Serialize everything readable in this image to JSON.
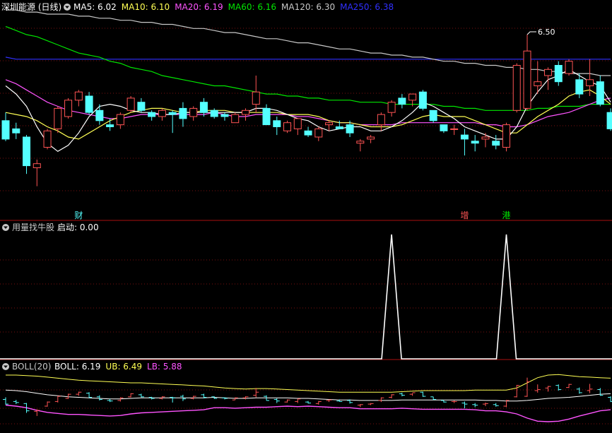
{
  "colors": {
    "up": "#ff5454",
    "down": "#54ffff",
    "ma5": "#ffffff",
    "ma10": "#ffff54",
    "ma20": "#ff54ff",
    "ma60": "#00e600",
    "ma120": "#c8c8c8",
    "ma250": "#3030ff",
    "grid": "#7a1010",
    "panel_border": "#aa1010",
    "signal": "#ffffff",
    "boll_mid": "#ffffff",
    "boll_ub": "#ffff54",
    "boll_lb": "#ff54ff"
  },
  "main": {
    "title": "深圳能源 (日线)",
    "legend": [
      {
        "key": "ma5",
        "text": "MA5: 6.02"
      },
      {
        "key": "ma10",
        "text": "MA10: 6.10"
      },
      {
        "key": "ma20",
        "text": "MA20: 6.19"
      },
      {
        "key": "ma60",
        "text": "MA60: 6.16"
      },
      {
        "key": "ma120",
        "text": "MA120: 6.30"
      },
      {
        "key": "ma250",
        "text": "MA250: 6.38"
      }
    ],
    "high_annotation": "6.50",
    "markers": [
      {
        "text": "财",
        "index": 7,
        "color": "#54ffff"
      },
      {
        "text": "增",
        "index": 44,
        "color": "#ff5454"
      },
      {
        "text": "港",
        "index": 48,
        "color": "#00e600"
      }
    ]
  },
  "indicator": {
    "title": "用量找牛股",
    "legend": [
      {
        "key": "signal",
        "text": "启动: 0.00"
      }
    ]
  },
  "boll": {
    "title": "BOLL(20)",
    "legend": [
      {
        "key": "boll_mid",
        "text": "BOLL: 6.19"
      },
      {
        "key": "boll_ub",
        "text": "UB: 6.49"
      },
      {
        "key": "boll_lb",
        "text": "LB: 5.88"
      }
    ]
  },
  "chart_data": [
    {
      "type": "candlestick",
      "yrange": [
        5.6,
        6.6
      ],
      "ohlc": [
        [
          6.08,
          6.12,
          5.98,
          5.99
        ],
        [
          6.04,
          6.07,
          5.99,
          6.02
        ],
        [
          6.0,
          6.01,
          5.82,
          5.86
        ],
        [
          5.85,
          5.89,
          5.76,
          5.87
        ],
        [
          5.95,
          6.04,
          5.94,
          6.03
        ],
        [
          6.04,
          6.15,
          6.02,
          6.14
        ],
        [
          6.1,
          6.19,
          6.09,
          6.18
        ],
        [
          6.18,
          6.23,
          6.15,
          6.22
        ],
        [
          6.2,
          6.22,
          6.11,
          6.12
        ],
        [
          6.13,
          6.16,
          6.06,
          6.08
        ],
        [
          6.06,
          6.09,
          6.03,
          6.05
        ],
        [
          6.06,
          6.12,
          6.04,
          6.11
        ],
        [
          6.13,
          6.2,
          6.12,
          6.19
        ],
        [
          6.17,
          6.19,
          6.12,
          6.13
        ],
        [
          6.12,
          6.13,
          6.08,
          6.1
        ],
        [
          6.1,
          6.14,
          6.08,
          6.13
        ],
        [
          6.12,
          6.13,
          6.02,
          6.11
        ],
        [
          6.14,
          6.17,
          6.05,
          6.09
        ],
        [
          6.1,
          6.15,
          6.08,
          6.14
        ],
        [
          6.17,
          6.19,
          6.1,
          6.12
        ],
        [
          6.13,
          6.14,
          6.09,
          6.1
        ],
        [
          6.11,
          6.12,
          6.08,
          6.1
        ],
        [
          6.07,
          6.12,
          6.07,
          6.11
        ],
        [
          6.11,
          6.14,
          6.08,
          6.13
        ],
        [
          6.16,
          6.3,
          6.12,
          6.22
        ],
        [
          6.14,
          6.16,
          6.06,
          6.06
        ],
        [
          6.08,
          6.1,
          6.01,
          6.05
        ],
        [
          6.03,
          6.08,
          6.02,
          6.07
        ],
        [
          6.04,
          6.09,
          6.01,
          6.09
        ],
        [
          6.03,
          6.05,
          6.0,
          6.01
        ],
        [
          6.0,
          6.05,
          5.98,
          6.04
        ],
        [
          6.06,
          6.08,
          6.03,
          6.07
        ],
        [
          6.05,
          6.08,
          6.04,
          6.04
        ],
        [
          6.06,
          6.08,
          6.0,
          6.02
        ],
        [
          5.97,
          5.99,
          5.93,
          5.98
        ],
        [
          5.99,
          6.01,
          5.97,
          6.0
        ],
        [
          6.06,
          6.12,
          6.03,
          6.11
        ],
        [
          6.12,
          6.18,
          6.1,
          6.17
        ],
        [
          6.19,
          6.21,
          6.14,
          6.16
        ],
        [
          6.18,
          6.2,
          6.15,
          6.21
        ],
        [
          6.22,
          6.23,
          6.13,
          6.14
        ],
        [
          6.13,
          6.13,
          6.07,
          6.08
        ],
        [
          6.06,
          6.06,
          6.02,
          6.03
        ],
        [
          6.04,
          6.06,
          6.01,
          6.04
        ],
        [
          6.01,
          6.04,
          5.91,
          5.99
        ],
        [
          5.98,
          6.01,
          5.93,
          5.97
        ],
        [
          5.99,
          6.02,
          5.95,
          6.0
        ],
        [
          5.98,
          6.01,
          5.94,
          5.96
        ],
        [
          5.95,
          6.07,
          5.93,
          6.06
        ],
        [
          6.13,
          6.36,
          6.12,
          6.35
        ],
        [
          6.14,
          6.5,
          6.13,
          6.42
        ],
        [
          6.25,
          6.37,
          6.21,
          6.27
        ],
        [
          6.3,
          6.34,
          6.23,
          6.33
        ],
        [
          6.35,
          6.37,
          6.25,
          6.27
        ],
        [
          6.31,
          6.38,
          6.3,
          6.37
        ],
        [
          6.28,
          6.31,
          6.19,
          6.21
        ],
        [
          6.25,
          6.38,
          6.2,
          6.28
        ],
        [
          6.27,
          6.3,
          6.15,
          6.16
        ],
        [
          6.12,
          6.14,
          6.03,
          6.04
        ]
      ],
      "ma": {
        "ma5": [
          6.25,
          6.21,
          6.15,
          6.05,
          5.97,
          5.93,
          5.96,
          6.02,
          6.1,
          6.15,
          6.16,
          6.15,
          6.13,
          6.12,
          6.12,
          6.11,
          6.11,
          6.12,
          6.12,
          6.12,
          6.12,
          6.12,
          6.12,
          6.12,
          6.14,
          6.14,
          6.13,
          6.11,
          6.09,
          6.08,
          6.05,
          6.03,
          6.04,
          6.05,
          6.05,
          6.03,
          6.03,
          6.05,
          6.08,
          6.12,
          6.17,
          6.15,
          6.12,
          6.09,
          6.05,
          6.03,
          6.01,
          5.99,
          5.99,
          6.05,
          6.15,
          6.22,
          6.28,
          6.3,
          6.33,
          6.3,
          6.27,
          6.25,
          6.17
        ],
        "ma10": [
          6.12,
          6.11,
          6.1,
          6.08,
          6.05,
          6.03,
          6.0,
          5.99,
          6.02,
          6.05,
          6.08,
          6.1,
          6.12,
          6.13,
          6.14,
          6.14,
          6.13,
          6.12,
          6.12,
          6.13,
          6.13,
          6.13,
          6.12,
          6.12,
          6.12,
          6.12,
          6.12,
          6.11,
          6.11,
          6.11,
          6.1,
          6.08,
          6.07,
          6.07,
          6.06,
          6.05,
          6.05,
          6.05,
          6.06,
          6.08,
          6.1,
          6.11,
          6.1,
          6.1,
          6.1,
          6.08,
          6.06,
          6.04,
          6.02,
          6.02,
          6.06,
          6.1,
          6.13,
          6.16,
          6.2,
          6.22,
          6.23,
          6.2,
          6.16
        ],
        "ma20": [
          6.28,
          6.26,
          6.23,
          6.2,
          6.17,
          6.15,
          6.13,
          6.12,
          6.11,
          6.1,
          6.09,
          6.09,
          6.1,
          6.11,
          6.11,
          6.11,
          6.11,
          6.11,
          6.11,
          6.11,
          6.12,
          6.11,
          6.1,
          6.1,
          6.11,
          6.11,
          6.11,
          6.11,
          6.1,
          6.1,
          6.09,
          6.08,
          6.07,
          6.07,
          6.06,
          6.06,
          6.06,
          6.06,
          6.07,
          6.07,
          6.07,
          6.07,
          6.07,
          6.07,
          6.07,
          6.07,
          6.06,
          6.06,
          6.05,
          6.05,
          6.06,
          6.08,
          6.1,
          6.11,
          6.12,
          6.14,
          6.16,
          6.18,
          6.19
        ],
        "ma60": [
          6.54,
          6.52,
          6.5,
          6.49,
          6.47,
          6.45,
          6.43,
          6.41,
          6.4,
          6.39,
          6.37,
          6.36,
          6.34,
          6.33,
          6.32,
          6.3,
          6.29,
          6.28,
          6.27,
          6.26,
          6.25,
          6.25,
          6.24,
          6.23,
          6.22,
          6.21,
          6.21,
          6.2,
          6.2,
          6.19,
          6.19,
          6.18,
          6.18,
          6.18,
          6.17,
          6.17,
          6.17,
          6.16,
          6.16,
          6.16,
          6.16,
          6.16,
          6.15,
          6.15,
          6.14,
          6.14,
          6.13,
          6.13,
          6.13,
          6.13,
          6.13,
          6.14,
          6.14,
          6.15,
          6.15,
          6.15,
          6.16,
          6.16,
          6.16
        ],
        "ma120": [
          6.62,
          6.62,
          6.61,
          6.61,
          6.6,
          6.6,
          6.6,
          6.59,
          6.59,
          6.58,
          6.58,
          6.57,
          6.57,
          6.56,
          6.56,
          6.55,
          6.55,
          6.54,
          6.53,
          6.53,
          6.52,
          6.51,
          6.51,
          6.5,
          6.49,
          6.48,
          6.48,
          6.47,
          6.46,
          6.46,
          6.45,
          6.44,
          6.43,
          6.43,
          6.42,
          6.41,
          6.41,
          6.4,
          6.4,
          6.39,
          6.39,
          6.38,
          6.37,
          6.37,
          6.36,
          6.36,
          6.35,
          6.35,
          6.34,
          6.34,
          6.33,
          6.33,
          6.32,
          6.32,
          6.31,
          6.31,
          6.31,
          6.3,
          6.3
        ],
        "ma250": [
          6.39,
          6.38,
          6.38,
          6.38,
          6.38,
          6.38,
          6.38,
          6.38,
          6.38,
          6.38,
          6.38,
          6.38,
          6.38,
          6.38,
          6.38,
          6.38,
          6.38,
          6.38,
          6.38,
          6.38,
          6.38,
          6.38,
          6.38,
          6.38,
          6.38,
          6.38,
          6.38,
          6.38,
          6.38,
          6.38,
          6.38,
          6.38,
          6.38,
          6.38,
          6.38,
          6.38,
          6.38,
          6.38,
          6.38,
          6.38,
          6.38,
          6.38,
          6.38,
          6.38,
          6.38,
          6.38,
          6.38,
          6.38,
          6.38,
          6.38,
          6.38,
          6.38,
          6.38,
          6.38,
          6.38,
          6.38,
          6.38,
          6.38,
          6.38
        ]
      }
    },
    {
      "type": "line",
      "series": [
        {
          "values": [
            0,
            0,
            0,
            0,
            0,
            0,
            0,
            0,
            0,
            0,
            0,
            0,
            0,
            0,
            0,
            0,
            0,
            0,
            0,
            0,
            0,
            0,
            0,
            0,
            0,
            0,
            0,
            0,
            0,
            0,
            0,
            0,
            0,
            0,
            0,
            0,
            0,
            1,
            0,
            0,
            0,
            0,
            0,
            0,
            0,
            0,
            0,
            0,
            1,
            0,
            0,
            0,
            0,
            0,
            0,
            0,
            0,
            0,
            0
          ]
        }
      ],
      "yrange": [
        0,
        1
      ]
    },
    {
      "type": "bollinger",
      "yrange": [
        5.5,
        6.7
      ],
      "mid": [
        6.26,
        6.25,
        6.23,
        6.2,
        6.17,
        6.15,
        6.13,
        6.12,
        6.11,
        6.1,
        6.09,
        6.09,
        6.1,
        6.11,
        6.11,
        6.11,
        6.11,
        6.11,
        6.11,
        6.11,
        6.12,
        6.11,
        6.1,
        6.1,
        6.11,
        6.11,
        6.11,
        6.11,
        6.1,
        6.1,
        6.09,
        6.08,
        6.07,
        6.07,
        6.06,
        6.06,
        6.06,
        6.06,
        6.07,
        6.07,
        6.07,
        6.07,
        6.07,
        6.07,
        6.07,
        6.07,
        6.06,
        6.06,
        6.05,
        6.05,
        6.06,
        6.08,
        6.1,
        6.11,
        6.12,
        6.14,
        6.16,
        6.18,
        6.19
      ],
      "ub": [
        6.55,
        6.55,
        6.54,
        6.53,
        6.51,
        6.49,
        6.47,
        6.45,
        6.44,
        6.43,
        6.42,
        6.41,
        6.4,
        6.4,
        6.39,
        6.38,
        6.37,
        6.36,
        6.35,
        6.34,
        6.32,
        6.3,
        6.29,
        6.28,
        6.29,
        6.29,
        6.28,
        6.27,
        6.26,
        6.25,
        6.24,
        6.23,
        6.22,
        6.22,
        6.22,
        6.22,
        6.22,
        6.22,
        6.23,
        6.24,
        6.25,
        6.25,
        6.25,
        6.25,
        6.25,
        6.26,
        6.26,
        6.26,
        6.26,
        6.3,
        6.4,
        6.5,
        6.55,
        6.56,
        6.54,
        6.52,
        6.51,
        6.5,
        6.49
      ],
      "lb": [
        5.97,
        5.95,
        5.92,
        5.87,
        5.83,
        5.81,
        5.79,
        5.79,
        5.78,
        5.77,
        5.76,
        5.77,
        5.8,
        5.82,
        5.83,
        5.84,
        5.85,
        5.86,
        5.87,
        5.88,
        5.92,
        5.92,
        5.91,
        5.92,
        5.93,
        5.93,
        5.94,
        5.95,
        5.94,
        5.95,
        5.94,
        5.93,
        5.92,
        5.92,
        5.9,
        5.9,
        5.9,
        5.9,
        5.91,
        5.9,
        5.89,
        5.89,
        5.89,
        5.89,
        5.89,
        5.88,
        5.86,
        5.86,
        5.84,
        5.8,
        5.72,
        5.66,
        5.65,
        5.66,
        5.7,
        5.76,
        5.81,
        5.86,
        5.88
      ]
    }
  ]
}
